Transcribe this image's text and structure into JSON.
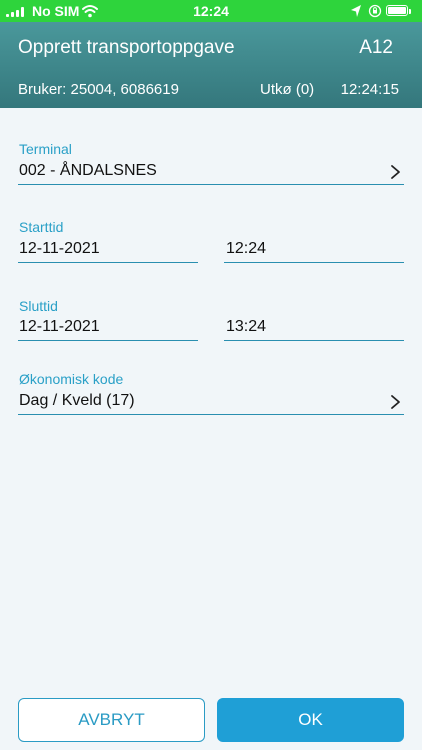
{
  "status_bar": {
    "carrier": "No SIM",
    "time": "12:24",
    "icons": [
      "signal-icon",
      "wifi-icon",
      "location-arrow-icon",
      "orientation-lock-icon",
      "battery-charging-icon"
    ]
  },
  "header": {
    "title": "Opprett transportoppgave",
    "code": "A12",
    "user": "Bruker: 25004, 6086619",
    "utko": "Utkø (0)",
    "clock": "12:24:15"
  },
  "form": {
    "terminal": {
      "label": "Terminal",
      "value": "002 - ÅNDALSNES"
    },
    "start": {
      "label": "Starttid",
      "date": "12-11-2021",
      "time": "12:24"
    },
    "end": {
      "label": "Sluttid",
      "date": "12-11-2021",
      "time": "13:24"
    },
    "economic_code": {
      "label": "Økonomisk kode",
      "value": "Dag / Kveld (17)"
    }
  },
  "buttons": {
    "cancel": "AVBRYT",
    "ok": "OK"
  },
  "colors": {
    "status_bar": "#2ed43c",
    "header": "#3d8a8e",
    "label": "#2aa0c7",
    "underline": "#2a8fb0",
    "primary": "#1f9fd6",
    "background": "#f1f6f9"
  }
}
